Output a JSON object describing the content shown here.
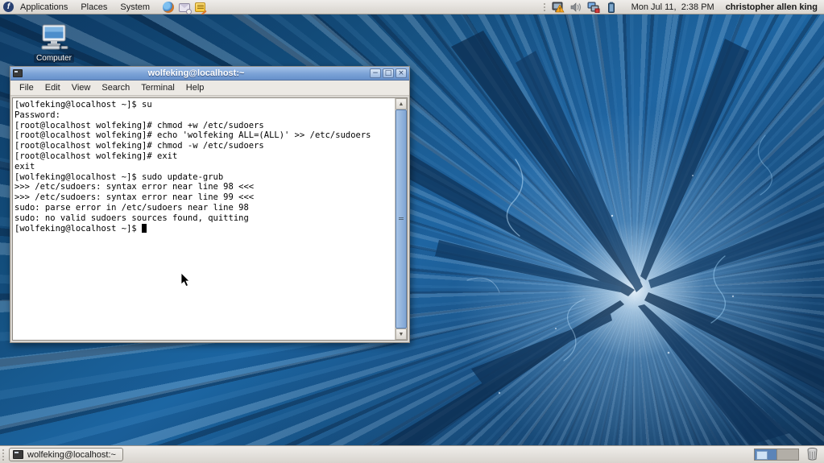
{
  "panel_top": {
    "menus": [
      {
        "label": "Applications"
      },
      {
        "label": "Places"
      },
      {
        "label": "System"
      }
    ],
    "launchers": [
      {
        "name": "firefox"
      },
      {
        "name": "email"
      },
      {
        "name": "writer"
      }
    ],
    "tray": [
      {
        "name": "display-warning"
      },
      {
        "name": "volume"
      },
      {
        "name": "network-offline"
      },
      {
        "name": "battery"
      }
    ],
    "clock": "Mon Jul 11,  2:38 PM",
    "user": "christopher allen king"
  },
  "desktop": {
    "computer_icon_label": "Computer"
  },
  "window": {
    "title": "wolfeking@localhost:~",
    "controls": {
      "minimize": "−",
      "maximize": "□",
      "close": "×"
    },
    "menu": {
      "items": [
        {
          "label": "File"
        },
        {
          "label": "Edit"
        },
        {
          "label": "View"
        },
        {
          "label": "Search"
        },
        {
          "label": "Terminal"
        },
        {
          "label": "Help"
        }
      ]
    },
    "scrollbar": {
      "up_arrow": "▲",
      "down_arrow": "▼"
    }
  },
  "terminal": {
    "lines": [
      "[wolfeking@localhost ~]$ su",
      "Password:",
      "[root@localhost wolfeking]# chmod +w /etc/sudoers",
      "[root@localhost wolfeking]# echo 'wolfeking ALL=(ALL)' >> /etc/sudoers",
      "[root@localhost wolfeking]# chmod -w /etc/sudoers",
      "[root@localhost wolfeking]# exit",
      "exit",
      "[wolfeking@localhost ~]$ sudo update-grub",
      ">>> /etc/sudoers: syntax error near line 98 <<<",
      ">>> /etc/sudoers: syntax error near line 99 <<<",
      "sudo: parse error in /etc/sudoers near line 98",
      "sudo: no valid sudoers sources found, quitting"
    ],
    "prompt_line": "[wolfeking@localhost ~]$ "
  },
  "panel_bottom": {
    "task_button_label": "wolfeking@localhost:~",
    "workspaces": {
      "count": 2,
      "active": 1
    }
  },
  "colors": {
    "titlebar_blue": "#7ba2d6",
    "panel_gray": "#d8d4ce",
    "wallpaper_deep_blue": "#0d3a64",
    "wallpaper_highlight": "#cfe6fa",
    "scroll_thumb_blue": "#7fa5d4",
    "workspace_active_blue": "#5b84b8"
  }
}
